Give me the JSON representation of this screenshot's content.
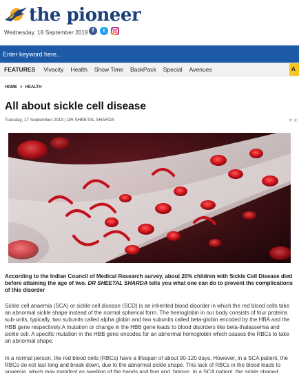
{
  "header": {
    "logo_text": "the pioneer",
    "date": "Wednesday, 18 September 2019",
    "social": {
      "facebook_glyph": "f",
      "twitter_glyph": "t"
    },
    "social_icons": [
      "facebook-icon",
      "twitter-icon",
      "instagram-icon"
    ]
  },
  "search": {
    "placeholder": "Enter keyword here..."
  },
  "nav": {
    "items": [
      "FEATURES",
      "Vivacity",
      "Health",
      "Show Time",
      "BackPack",
      "Special",
      "Avenues"
    ],
    "right_stub": "A"
  },
  "breadcrumb": {
    "home": "HOME",
    "separator": ">",
    "section": "HEALTH"
  },
  "article": {
    "title": "All about sickle cell disease",
    "date": "Tuesday, 17 September 2019",
    "author": "DR SHEETAL SHARDA",
    "byline_separator": "|",
    "lead_part1": "According to the Indian Council of Medical Research survey, about 20% children with Sickle Cell Disease died before attaining the age of two. ",
    "lead_author": "DR SHEETAL SHARDA",
    "lead_part2": " tells you what one can do to prevent the complications of this disorder",
    "paragraph1": "Sickle cell anaemia (SCA) or sickle cell disease (SCD) is an inherited blood disorder in which the red blood cells take an abnormal sickle shape instead of the normal spherical form. The hemoglobin in our body consists of four proteins sub-units, typically, two subunits called alpha globin and two subunits called beta-globin encoded by the HBA and the HBB gene respectively.A mutation or change in the HBB gene leads to blood disorders like beta-thalassemia and sickle cell. A specific mutation in the HBB gene encodes for an abnormal hemoglobin which causes the RBCs to take an abnormal shape.",
    "paragraph2": "In a normal person, the red blood cells (RBCs) have a lifespan of about 90-120 days. However, in a SCA patient, the RBCs do not last long and break down, due to the abnormal sickle shape. This lack of RBCs in the blood leads to anaemia, which may manifest as swelling of the hands and feet and, fatigue. In a SCA patient, the sickle shaped"
  },
  "colors": {
    "brand_blue": "#1c3f7a",
    "search_bar": "#1c5aa8",
    "accent_yellow": "#f7c51e"
  }
}
